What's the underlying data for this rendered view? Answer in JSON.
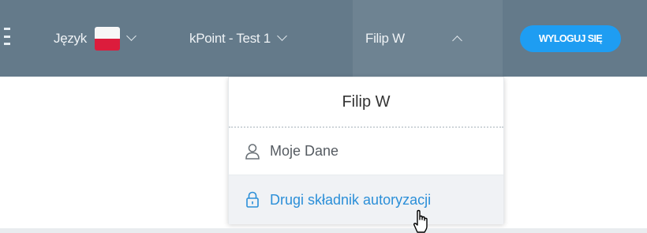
{
  "topbar": {
    "language_label": "Język",
    "language_flag": "poland-flag-icon",
    "account_label": "kPoint - Test 1",
    "user_label": "Filip W",
    "logout_label": "WYLOGUJ SIĘ",
    "colors": {
      "bar": "#647a8a",
      "user_active": "#6e8392",
      "logout": "#1e9df2"
    }
  },
  "user_menu": {
    "header": "Filip W",
    "items": [
      {
        "label": "Moje Dane",
        "icon": "user-icon"
      },
      {
        "label": "Drugi składnik autoryzacji",
        "icon": "lock-icon",
        "hovered": true
      }
    ],
    "accent": "#2b8fd8"
  }
}
